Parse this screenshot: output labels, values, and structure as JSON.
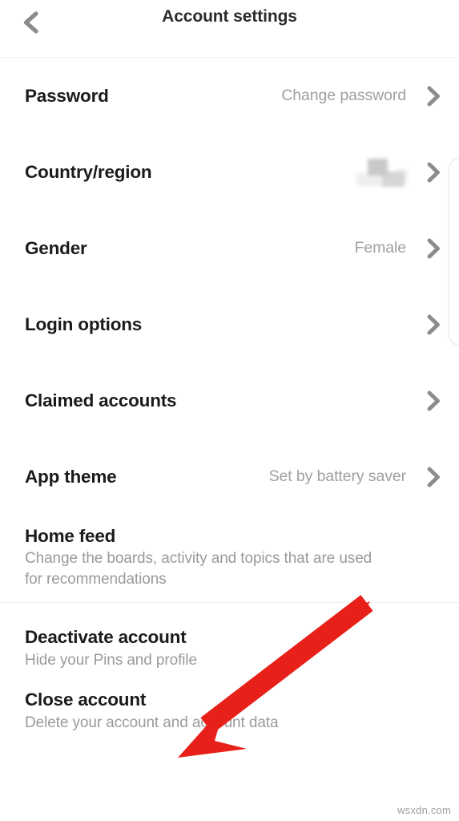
{
  "header": {
    "title": "Account settings",
    "back_icon": "chevron-left-icon"
  },
  "settings": {
    "rows": [
      {
        "title": "Password",
        "value": "Change password",
        "chevron": "chevron-right-icon"
      },
      {
        "title": "Country/region",
        "value": "",
        "redacted": true,
        "chevron": "chevron-right-icon"
      },
      {
        "title": "Gender",
        "value": "Female",
        "chevron": "chevron-right-icon"
      },
      {
        "title": "Login options",
        "value": "",
        "chevron": "chevron-right-icon"
      },
      {
        "title": "Claimed accounts",
        "value": "",
        "chevron": "chevron-right-icon"
      },
      {
        "title": "App theme",
        "value": "Set by battery saver",
        "chevron": "chevron-right-icon"
      }
    ],
    "home_feed": {
      "title": "Home feed",
      "description": "Change the boards, activity and topics that are used for recommendations"
    },
    "danger_rows": [
      {
        "title": "Deactivate account",
        "description": "Hide your Pins and profile"
      },
      {
        "title": "Close account",
        "description": "Delete your account and account data"
      }
    ]
  },
  "annotation": {
    "arrow_color": "#e8201a",
    "arrow_name": "red-callout-arrow"
  },
  "watermark": {
    "text": "wsxdn.com"
  }
}
